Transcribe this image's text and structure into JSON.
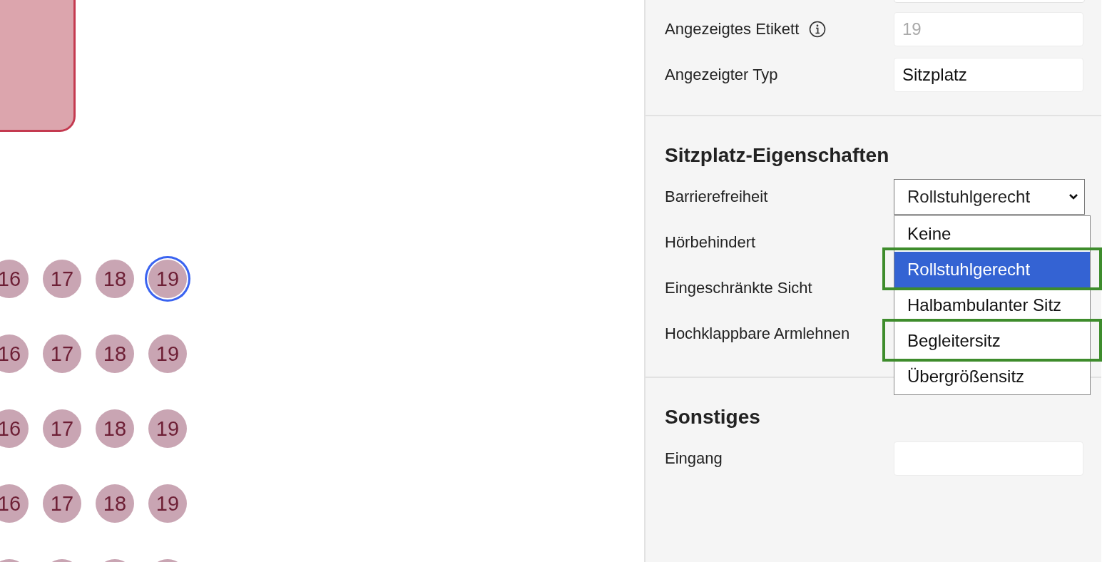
{
  "canvas": {
    "seat_rows": [
      {
        "seats": [
          {
            "label": "16",
            "selected": false
          },
          {
            "label": "17",
            "selected": false
          },
          {
            "label": "18",
            "selected": false
          },
          {
            "label": "19",
            "selected": true
          }
        ]
      },
      {
        "seats": [
          {
            "label": "16",
            "selected": false
          },
          {
            "label": "17",
            "selected": false
          },
          {
            "label": "18",
            "selected": false
          },
          {
            "label": "19",
            "selected": false
          }
        ]
      },
      {
        "seats": [
          {
            "label": "16",
            "selected": false
          },
          {
            "label": "17",
            "selected": false
          },
          {
            "label": "18",
            "selected": false
          },
          {
            "label": "19",
            "selected": false
          }
        ]
      },
      {
        "seats": [
          {
            "label": "16",
            "selected": false
          },
          {
            "label": "17",
            "selected": false
          },
          {
            "label": "18",
            "selected": false
          },
          {
            "label": "19",
            "selected": false
          }
        ]
      }
    ]
  },
  "panel": {
    "fields": [
      {
        "label": "Angezeigtes Etikett",
        "info": true,
        "placeholder": "19"
      },
      {
        "label": "Angezeigter Typ",
        "info": false,
        "value": "Sitzplatz"
      }
    ],
    "seat_properties": {
      "title": "Sitzplatz-Eigenschaften",
      "accessibility": {
        "label": "Barrierefreiheit",
        "value": "Rollstuhlgerecht",
        "options": [
          {
            "label": "Keine",
            "selected": false,
            "highlighted": false
          },
          {
            "label": "Rollstuhlgerecht",
            "selected": true,
            "highlighted": true
          },
          {
            "label": "Halbambulanter Sitz",
            "selected": false,
            "highlighted": false
          },
          {
            "label": "Begleitersitz",
            "selected": false,
            "highlighted": true
          },
          {
            "label": "Übergrößensitz",
            "selected": false,
            "highlighted": false
          }
        ]
      },
      "rows": [
        {
          "label": "Hörbehindert"
        },
        {
          "label": "Eingeschränkte Sicht"
        },
        {
          "label": "Hochklappbare Armlehnen"
        }
      ]
    },
    "other": {
      "title": "Sonstiges",
      "fields": [
        {
          "label": "Eingang"
        }
      ]
    }
  }
}
